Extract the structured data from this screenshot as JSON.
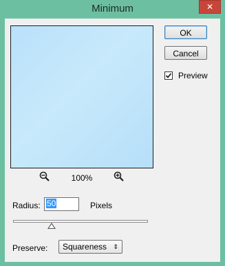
{
  "window": {
    "title": "Minimum",
    "close_glyph": "✕"
  },
  "buttons": {
    "ok": "OK",
    "cancel": "Cancel"
  },
  "preview_toggle": {
    "label": "Preview",
    "checked": true
  },
  "zoom": {
    "level": "100%"
  },
  "radius": {
    "label": "Radius:",
    "value": "50",
    "unit": "Pixels"
  },
  "preserve": {
    "label": "Preserve:",
    "value": "Squareness"
  }
}
